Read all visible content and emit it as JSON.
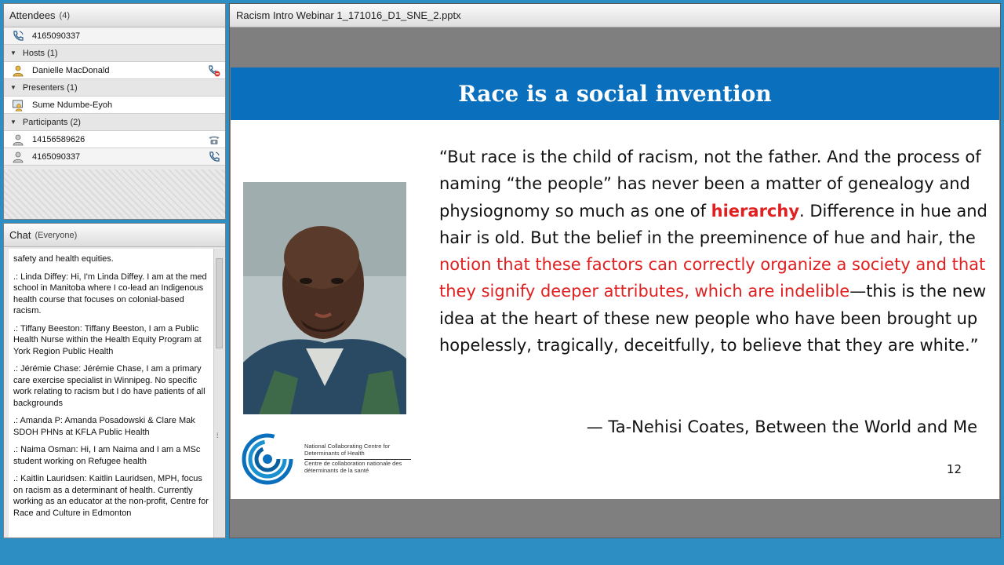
{
  "attendees": {
    "title": "Attendees",
    "count": "(4)",
    "top_row": "4165090337",
    "groups": [
      {
        "label": "Hosts (1)",
        "members": [
          {
            "name": "Danielle MacDonald"
          }
        ]
      },
      {
        "label": "Presenters (1)",
        "members": [
          {
            "name": "Sume Ndumbe-Eyoh"
          }
        ]
      },
      {
        "label": "Participants (2)",
        "members": [
          {
            "name": "14156589626"
          },
          {
            "name": "4165090337"
          }
        ]
      }
    ]
  },
  "chat": {
    "title": "Chat",
    "scope": "(Everyone)",
    "messages": [
      "safety and health equities.",
      ".: Linda Diffey: Hi, I'm Linda Diffey.  I am at the med school in Manitoba where I co-lead an Indigenous health course that focuses on colonial-based racism.",
      ".: Tiffany  Beeston: Tiffany Beeston, I am a Public Health Nurse within the Health Equity Program at York Region Public Health",
      ".: Jérémie Chase: Jérémie Chase, I am a primary care exercise specialist in Winnipeg. No specific work relating to racism but I do have patients of all backgrounds",
      ".: Amanda P: Amanda Posadowski & Clare Mak SDOH PHNs at KFLA Public Health",
      ".: Naima Osman: Hi, I am Naima and I am a MSc student working on Refugee health",
      ".: Kaitlin Lauridsen: Kaitlin Lauridsen, MPH, focus on racism as a determinant of health. Currently working as an educator at the non-profit, Centre for Race and Culture in Edmonton"
    ],
    "scroll_dots": "⁞"
  },
  "share": {
    "filename": "Racism Intro Webinar 1_171016_D1_SNE_2.pptx",
    "slide": {
      "title": "Race is a social invention",
      "quote": {
        "p1": "“But race is the child of racism, not the father. And the process of naming “the people” has never been a matter of genealogy and physiognomy so much as one of ",
        "p2": "hierarchy",
        "p3": ". Difference in hue and hair is old. But the belief in the preeminence of hue and hair, the ",
        "p4": "notion that these factors can correctly organize a society and that they signify deeper attributes, which are indelible",
        "p5": "—this is the new idea at the heart of these new people who have been brought up hopelessly, tragically, deceitfully, to believe that they are white.”"
      },
      "attribution": "— Ta-Nehisi Coates, Between the World and Me",
      "logo_en": "National Collaborating Centre for Determinants of Health",
      "logo_fr": "Centre de collaboration nationale des déterminants de la santé",
      "page_number": "12"
    }
  }
}
